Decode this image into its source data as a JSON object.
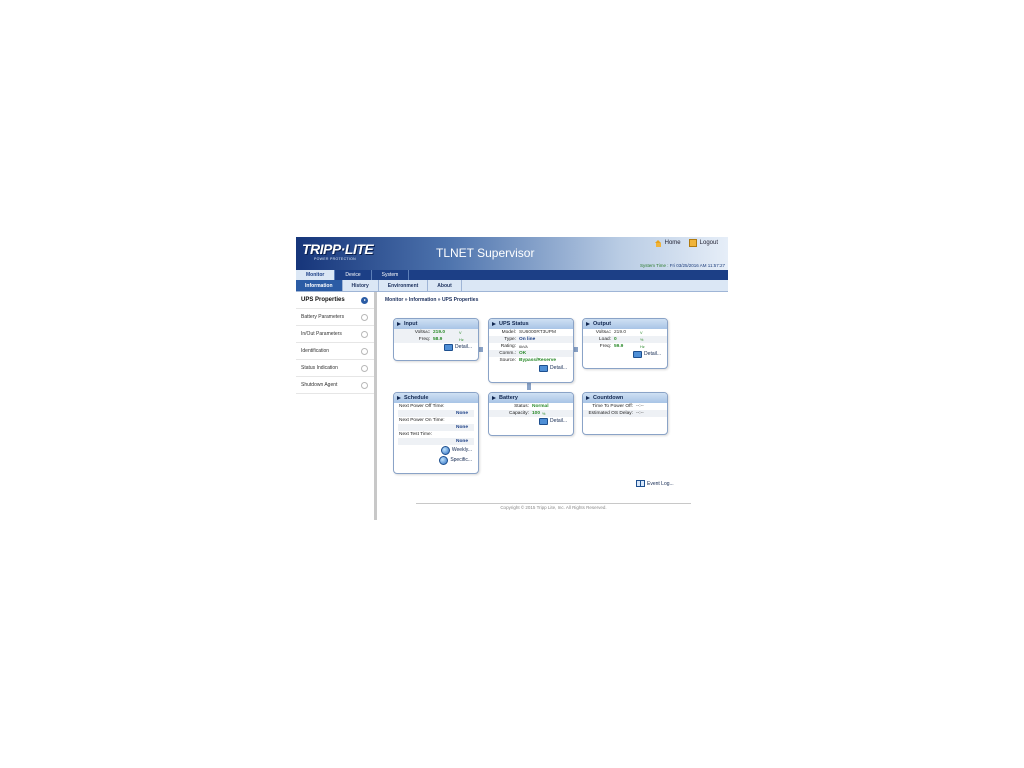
{
  "header": {
    "logo_text": "TRIPP·LITE",
    "logo_tagline": "POWER PROTECTION",
    "title": "TLNET Supervisor",
    "home_label": "Home",
    "logout_label": "Logout",
    "system_time_label": "System Time :",
    "system_time_value": "Fri 03/25/2016 AM 11:57:27"
  },
  "main_nav": [
    "Monitor",
    "Device",
    "System"
  ],
  "sub_nav": [
    "Information",
    "History",
    "Environment",
    "About"
  ],
  "sidebar": [
    "UPS Properties",
    "Battery Parameters",
    "In/Out Parameters",
    "Identification",
    "Status Indication",
    "Shutdown Agent"
  ],
  "breadcrumb": "Monitor » Information » UPS Properties",
  "panels": {
    "input": {
      "title": "Input",
      "volts_label": "Volts",
      "volts_sub": "AC",
      "volts_value": "219.0",
      "volts_unit": "V",
      "freq_label": "Freq:",
      "freq_value": "58.9",
      "freq_unit": "Hz",
      "detail": "Detail..."
    },
    "ups_status": {
      "title": "UPS Status",
      "model_label": "Model:",
      "model_value": "SU6000RT3UPM",
      "type_label": "Type:",
      "type_value": "On line",
      "rating_label": "Rating:",
      "rating_value": "6kVA",
      "comm_label": "Comm.:",
      "comm_value": "OK",
      "source_label": "Source:",
      "source_value": "Bypass/Reserve",
      "detail": "Detail..."
    },
    "output": {
      "title": "Output",
      "volts_label": "Volts",
      "volts_sub": "AC",
      "volts_value": "219.0",
      "volts_unit": "V",
      "load_label": "Load:",
      "load_value": "0",
      "load_unit": "%",
      "freq_label": "Freq:",
      "freq_value": "59.9",
      "freq_unit": "Hz",
      "detail": "Detail..."
    },
    "schedule": {
      "title": "Schedule",
      "off_label": "Next Power Off Time:",
      "off_value": "None",
      "on_label": "Next Power On Time:",
      "on_value": "None",
      "test_label": "Next Test Time:",
      "test_value": "None",
      "weekly": "Weekly...",
      "specific": "Specific..."
    },
    "battery": {
      "title": "Battery",
      "status_label": "Status:",
      "status_value": "Normal",
      "capacity_label": "Capacity:",
      "capacity_value": "100",
      "capacity_unit": "%",
      "detail": "Detail..."
    },
    "countdown": {
      "title": "Countdown",
      "tpo_label": "Time To Power Off:",
      "tpo_value": "--:--",
      "osd_label": "Estimated OS Delay:",
      "osd_value": "--:--"
    }
  },
  "event_log": "Event Log...",
  "copyright": "Copyright © 2015 Tripp Lite, Inc. All Rights Reserved."
}
